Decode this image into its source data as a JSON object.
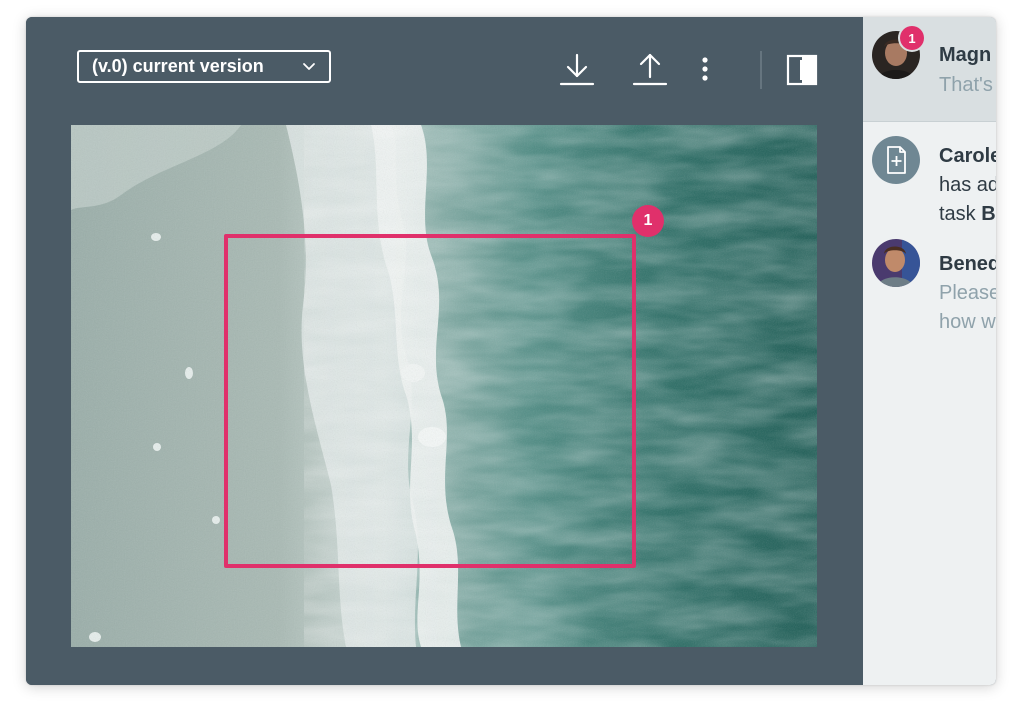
{
  "toolbar": {
    "version_label": "(v.0) current version",
    "download_icon": "download-icon",
    "upload_icon": "upload-icon",
    "more_icon": "more-vertical-icon",
    "panel_toggle_icon": "panel-toggle-icon"
  },
  "annotation": {
    "number": "1",
    "color": "#e0306b"
  },
  "activity": [
    {
      "name": "Magn",
      "text": "That's",
      "badge": "1"
    },
    {
      "name": "Carole",
      "line1": "has ad",
      "line2_prefix": "task ",
      "line2_bold": "B",
      "icon": "add-document-icon"
    },
    {
      "name": "Bened",
      "line1": "Please",
      "line2": "how w"
    }
  ],
  "colors": {
    "viewer_bg": "#4b5b66",
    "panel_bg": "#eef1f2",
    "accent": "#e0306b"
  }
}
